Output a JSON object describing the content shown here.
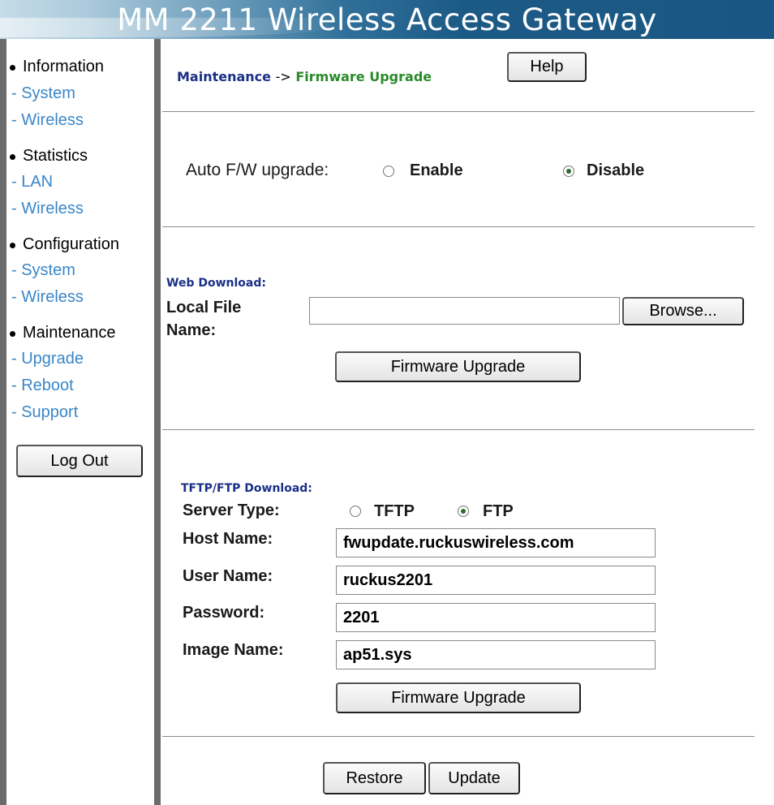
{
  "header": {
    "title": "MM 2211 Wireless Access Gateway"
  },
  "sidebar": {
    "groups": [
      {
        "label": "Information",
        "links": [
          "- System",
          "- Wireless"
        ]
      },
      {
        "label": "Statistics",
        "links": [
          "- LAN",
          "- Wireless"
        ]
      },
      {
        "label": "Configuration",
        "links": [
          "- System",
          "- Wireless"
        ]
      },
      {
        "label": "Maintenance",
        "links": [
          "- Upgrade",
          "- Reboot",
          "- Support"
        ]
      }
    ],
    "logout_label": "Log Out"
  },
  "breadcrumb": {
    "section": "Maintenance",
    "arrow": "->",
    "page": "Firmware Upgrade"
  },
  "help_label": "Help",
  "auto_upgrade": {
    "label": "Auto F/W upgrade:",
    "enable": "Enable",
    "disable": "Disable",
    "selected": "Disable"
  },
  "web_download": {
    "title": "Web Download:",
    "file_label_line1": "Local File",
    "file_label_line2": "Name:",
    "file_value": "",
    "browse_label": "Browse...",
    "upgrade_label": "Firmware Upgrade"
  },
  "tftp": {
    "title": "TFTP/FTP Download:",
    "server_type_label": "Server Type:",
    "tftp_label": "TFTP",
    "ftp_label": "FTP",
    "selected": "FTP",
    "host_label": "Host Name:",
    "host_value": "fwupdate.ruckuswireless.com",
    "user_label": "User Name:",
    "user_value": "ruckus2201",
    "password_label": "Password:",
    "password_value": "2201",
    "image_label": "Image Name:",
    "image_value": "ap51.sys",
    "upgrade_label": "Firmware Upgrade"
  },
  "footer_buttons": {
    "restore": "Restore",
    "update": "Update"
  }
}
